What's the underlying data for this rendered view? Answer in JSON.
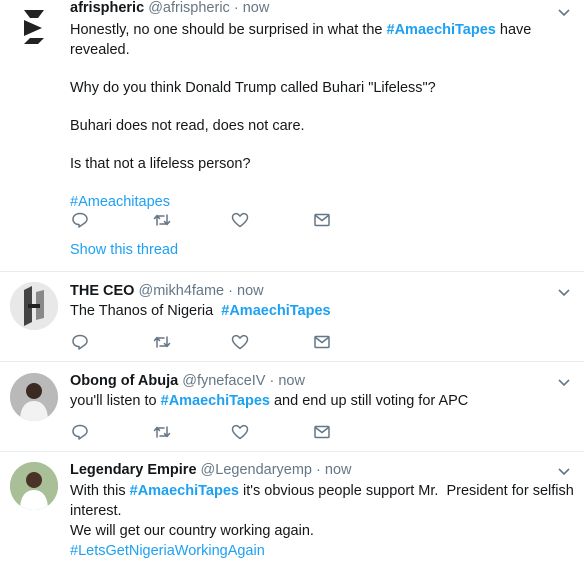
{
  "tweets": [
    {
      "name": "afrispheric",
      "handle": "@afrispheric",
      "time": "now",
      "line1_pre": "Honestly, no one should be surprised in what the ",
      "line1_tag": "#AmaechiTapes",
      "line1_post": " have revealed.",
      "line2": "Why do you think Donald Trump called Buhari \"Lifeless\"?",
      "line3": "Buhari does not read, does not care.",
      "line4": "Is that not a lifeless person?",
      "hashtag": "#Ameachitapes",
      "show_thread": "Show this thread"
    },
    {
      "name": "THE CEO",
      "handle": "@mikh4fame",
      "time": "now",
      "text_pre": "The Thanos of Nigeria  ",
      "text_tag": "#AmaechiTapes"
    },
    {
      "name": "Obong of Abuja",
      "handle": "@fynefaceIV",
      "time": "now",
      "text_pre": "you'll listen to ",
      "text_tag": "#AmaechiTapes",
      "text_post": " and end up still voting for APC"
    },
    {
      "name": "Legendary Empire",
      "handle": "@Legendaryemp",
      "time": "now",
      "line1_pre": "With this ",
      "line1_tag": "#AmaechiTapes",
      "line1_post": " it's obvious people support Mr.  President for selfish",
      "line2": "interest.",
      "line3": "We will get our country working again.",
      "hashtag": "#LetsGetNigeriaWorkingAgain"
    }
  ],
  "separator": " · ",
  "icons": [
    "reply-icon",
    "retweet-icon",
    "like-icon",
    "dm-icon",
    "chevron-down-icon"
  ],
  "colors": {
    "link": "#1da1f2",
    "muted": "#657786",
    "text": "#14171a",
    "border": "#e6ecf0"
  }
}
